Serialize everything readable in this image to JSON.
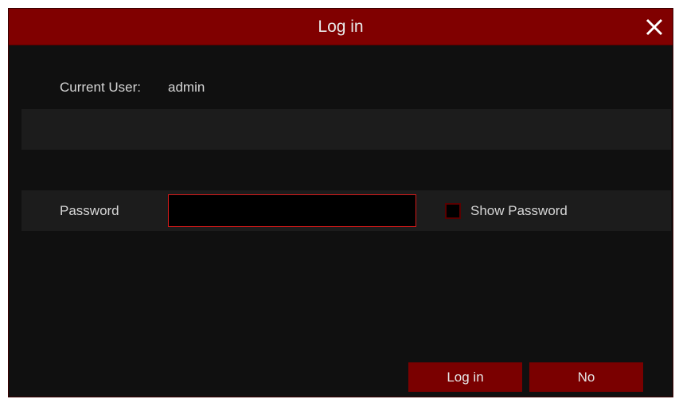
{
  "dialog": {
    "title": "Log in",
    "close_icon": "close-icon"
  },
  "user": {
    "label": "Current User:",
    "value": "admin"
  },
  "password": {
    "label": "Password",
    "value": "",
    "show_password_label": "Show Password",
    "show_password_checked": false
  },
  "buttons": {
    "login_label": "Log in",
    "no_label": "No"
  },
  "colors": {
    "titlebar": "#800000",
    "background": "#101010",
    "band": "#1c1c1c",
    "button": "#7a0000",
    "input_border": "#d41a1a"
  }
}
